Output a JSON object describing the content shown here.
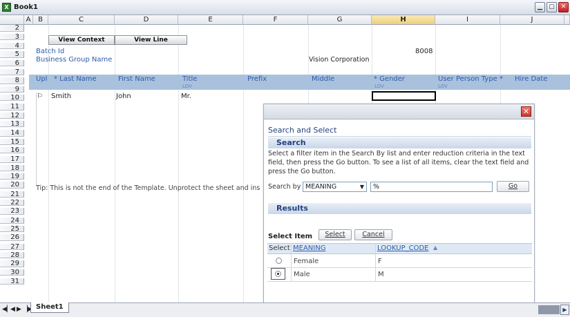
{
  "window": {
    "title": "Book1",
    "app_icon": "excel-icon",
    "controls": [
      "minimize",
      "maximize",
      "close"
    ]
  },
  "columns": [
    "A",
    "B",
    "C",
    "D",
    "E",
    "F",
    "G",
    "H",
    "I",
    "J"
  ],
  "selected_column": "H",
  "rows": [
    "2",
    "3",
    "4",
    "5",
    "6",
    "7",
    "8",
    "9",
    "10",
    "11",
    "12",
    "13",
    "14",
    "15",
    "16",
    "17",
    "18",
    "19",
    "20",
    "21",
    "22",
    "23",
    "24",
    "25",
    "26",
    "27",
    "28",
    "29",
    "30",
    "31"
  ],
  "toolbar": {
    "view_context": "View Context",
    "view_line": "View Line"
  },
  "batch": {
    "batch_id_label": "Batch Id",
    "business_group_label": "Business Group Name",
    "business_group_value": "Vision Corporation",
    "batch_id_value": "8008"
  },
  "headers": {
    "upl": "Upl",
    "last_name": "* Last Name",
    "first_name": "First Name",
    "title": "Title",
    "title_sub": "LOV",
    "prefix": "Prefix",
    "middle": "Middle",
    "gender": "* Gender",
    "gender_sub": "LOV",
    "person_type": "User Person Type *",
    "person_type_sub": "LOV",
    "hire_date": "Hire Date"
  },
  "row1": {
    "flag": "⚐",
    "last_name": "Smith",
    "first_name": "John",
    "title": "Mr."
  },
  "tip": "Tip: This is not the end of the Template.  Unprotect the sheet and ins",
  "dialog": {
    "heading": "Search and Select",
    "search_section": "Search",
    "instructions": "Select a filter item in the Search By list and enter reduction criteria in the text field, then press the Go button. To see a list of all items, clear the text field and press the Go button.",
    "search_by_label": "Search by",
    "search_by_value": "MEANING",
    "search_text": "%",
    "go_button": "Go",
    "results_section": "Results",
    "select_item_label": "Select Item",
    "select_button": "Select",
    "cancel_button": "Cancel",
    "col_select": "Select",
    "col_meaning": "MEANING",
    "col_lookup": "LOOKUP_CODE",
    "results": [
      {
        "meaning": "Female",
        "code": "F",
        "selected": false
      },
      {
        "meaning": "Male",
        "code": "M",
        "selected": true
      }
    ]
  },
  "sheet_tab": "Sheet1"
}
